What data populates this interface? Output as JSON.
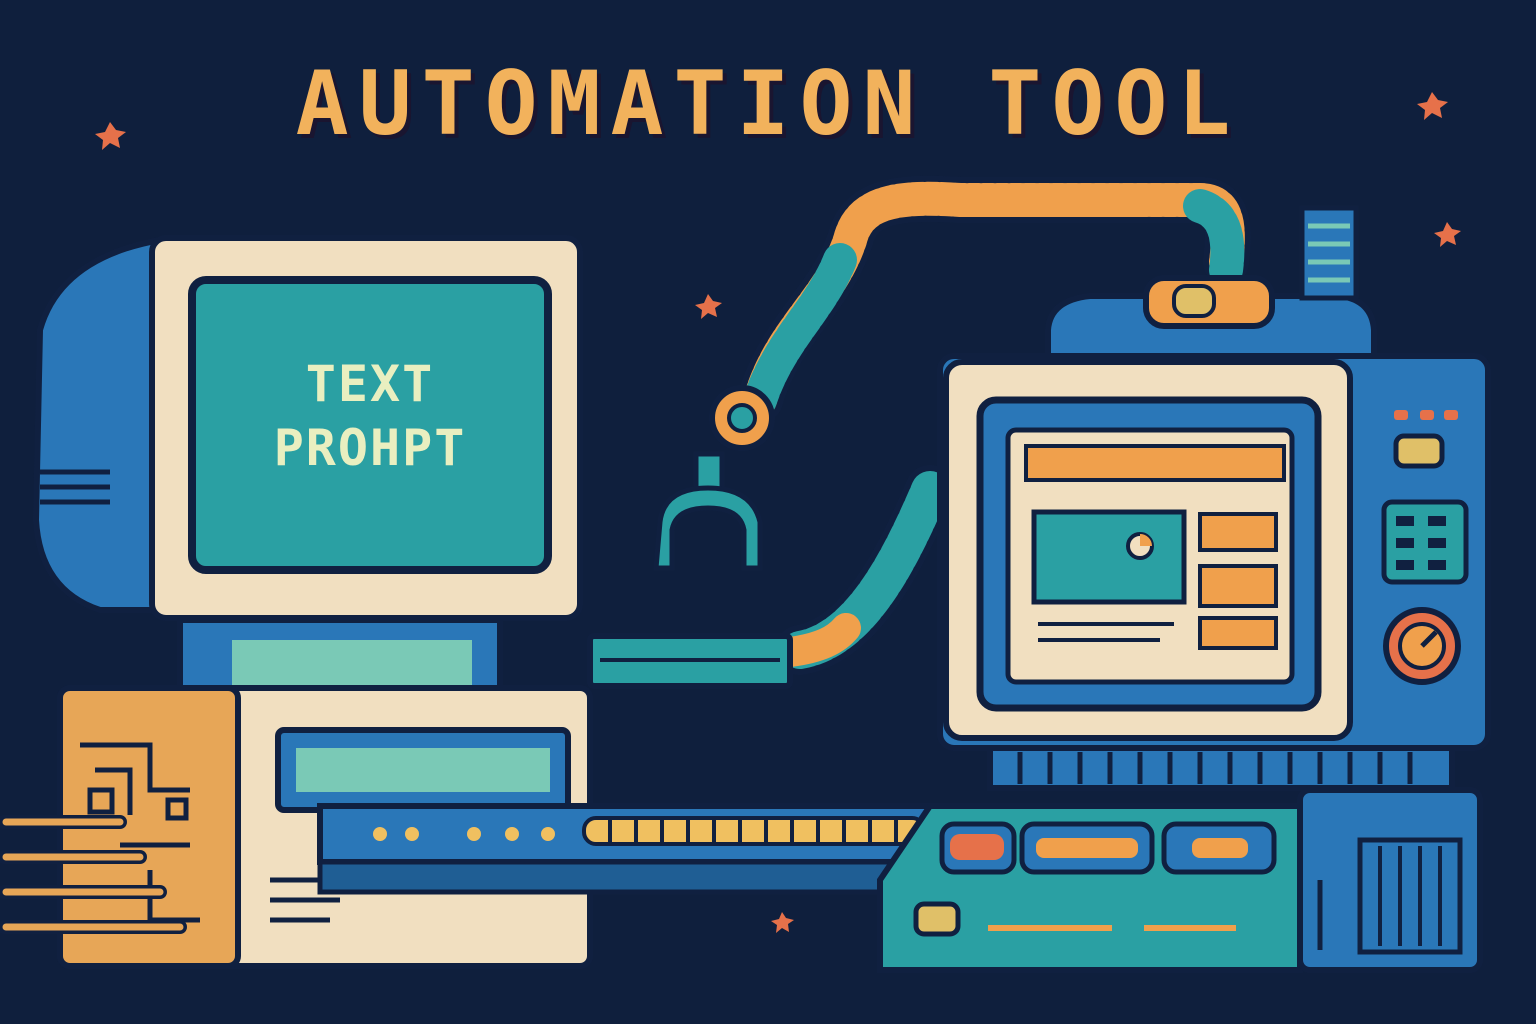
{
  "title": "AUTOMATION TOOL",
  "left_monitor": {
    "screen_line1": "TEXT",
    "screen_line2": "PROHPT"
  },
  "colors": {
    "background": "#0f1f3d",
    "title": "#f2b25c",
    "beige": "#f1dfc0",
    "teal": "#2aa0a3",
    "blue": "#2a77b8",
    "orange": "#f0a04c",
    "dark_outline": "#102040"
  },
  "icons": [
    "robot-arm-icon",
    "gripper-icon",
    "dial-knob-icon",
    "star-icon"
  ]
}
